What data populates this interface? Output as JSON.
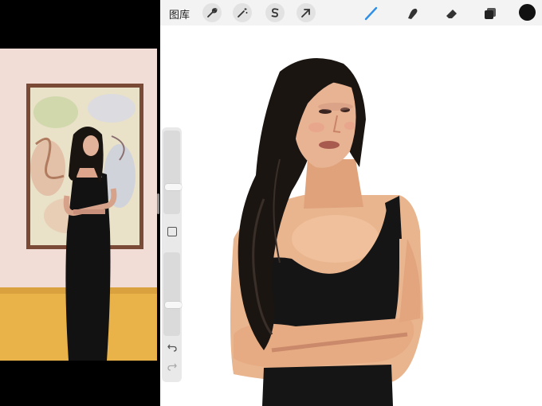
{
  "toolbar": {
    "gallery_label": "图库",
    "actions_icon": "wrench-icon",
    "adjustments_icon": "magic-wand-icon",
    "selection_icon": "selection-s-icon",
    "transform_icon": "arrow-cursor-icon",
    "brush_icon": "brush-icon",
    "smudge_icon": "smudge-icon",
    "eraser_icon": "eraser-icon",
    "layers_icon": "layers-icon",
    "current_color": "#111111",
    "active_tool_color": "#2f8fe6"
  },
  "sidebar": {
    "brush_size_level": 0.45,
    "opacity_level": 0.35,
    "modify_icon": "square-icon",
    "undo_icon": "undo-icon",
    "redo_icon": "redo-icon"
  }
}
